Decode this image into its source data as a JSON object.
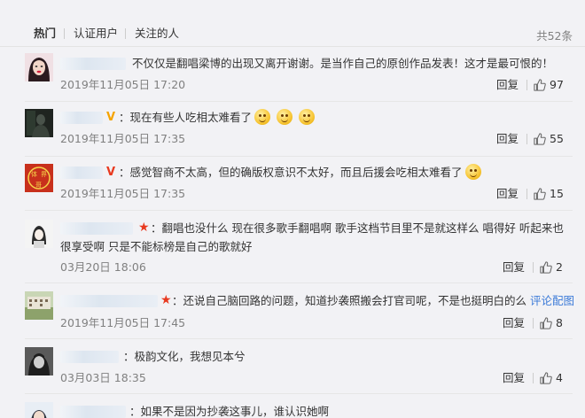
{
  "tabs": {
    "hot": "热门",
    "verified": "认证用户",
    "following": "关注的人",
    "total": "共52条"
  },
  "comments": [
    {
      "text": "不仅仅是翻唱梁博的出现又离开谢谢。是当作自己的原创作品发表！这才是最可恨的！",
      "time": "2019年11月05日 17:20",
      "reply": "回复",
      "likes": "97",
      "avatar_icon": "avatar-woman-red-lips"
    },
    {
      "text": "现在有些人吃相太难看了",
      "time": "2019年11月05日 17:35",
      "reply": "回复",
      "likes": "55",
      "badge": "V",
      "badge_color": "#f5a300",
      "avatar_icon": "avatar-dark-figure"
    },
    {
      "text": "感觉智商不太高，但的确版权意识不太好，而且后援会吃相太难看了",
      "time": "2019年11月05日 17:35",
      "reply": "回复",
      "likes": "15",
      "badge": "V",
      "badge_color": "#e8391f",
      "avatar_icon": "avatar-red-seal",
      "avatar_text": "体 界 · 哥"
    },
    {
      "text": "翻唱也没什么 现在很多歌手翻唱啊 歌手这档节目里不是就这样么 唱得好 听起来也很享受啊 只是不能标榜是自己的歌就好",
      "time": "03月20日 18:06",
      "reply": "回复",
      "likes": "2",
      "avatar_icon": "avatar-sketch-girl"
    },
    {
      "text": "还说自己脑回路的问题，知道抄袭照搬会打官司呢，不是也挺明白的么",
      "link": "评论配图",
      "time": "2019年11月05日 17:45",
      "reply": "回复",
      "likes": "8",
      "avatar_icon": "avatar-building-photo"
    },
    {
      "text": "极韵文化，我想见本兮",
      "time": "03月03日 18:35",
      "reply": "回复",
      "likes": "4",
      "avatar_icon": "avatar-black-white-photo"
    },
    {
      "text": "如果不是因为抄袭这事儿，谁认识她啊",
      "avatar_icon": "avatar-partial"
    }
  ],
  "colors": {
    "background": "#f2f2f5",
    "link": "#3c7bd8",
    "muted": "#808080",
    "star": "#e8391f"
  }
}
